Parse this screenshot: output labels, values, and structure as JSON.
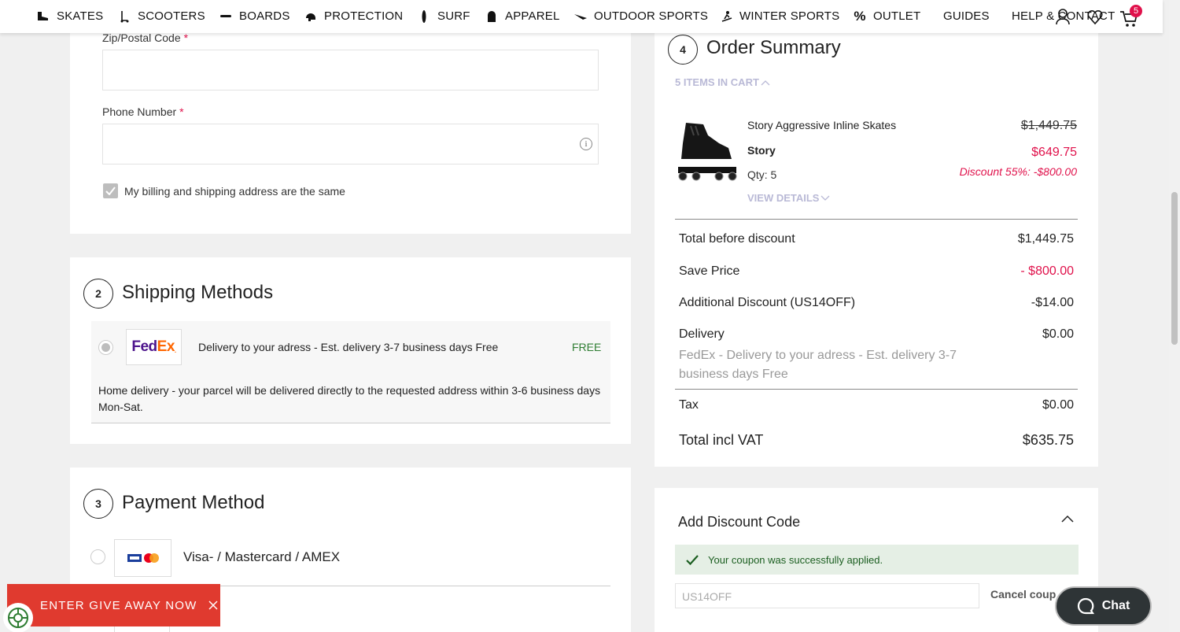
{
  "nav": {
    "items": [
      {
        "label": "SKATES",
        "icon": "skate-icon"
      },
      {
        "label": "SCOOTERS",
        "icon": "scooter-icon"
      },
      {
        "label": "BOARDS",
        "icon": "board-icon"
      },
      {
        "label": "PROTECTION",
        "icon": "helmet-icon"
      },
      {
        "label": "SURF",
        "icon": "surfboard-icon"
      },
      {
        "label": "APPAREL",
        "icon": "hoodie-icon"
      },
      {
        "label": "OUTDOOR SPORTS",
        "icon": "outdoor-icon"
      },
      {
        "label": "WINTER SPORTS",
        "icon": "skier-icon"
      },
      {
        "label": "OUTLET",
        "icon": "percent-icon"
      }
    ],
    "guides": "GUIDES",
    "help_contact": "HELP & CONTACT",
    "cart_count": "5"
  },
  "address": {
    "zip_label": "Zip/Postal Code",
    "phone_label": "Phone Number",
    "required_mark": "*",
    "zip_value": "",
    "phone_value": "",
    "billing_same_label": "My billing and shipping address are the same",
    "billing_same_checked": true
  },
  "shipping": {
    "step": "2",
    "title": "Shipping Methods",
    "carrier_logo_text_1": "Fed",
    "carrier_logo_text_2": "Ex",
    "option_label": "Delivery to your adress - Est. delivery 3-7 business days Free",
    "option_price": "FREE",
    "description": "Home delivery - your parcel will be delivered directly to the requested address within 3-6 business days Mon-Sat."
  },
  "payment": {
    "step": "3",
    "title": "Payment Method",
    "option_label": "Visa- / Mastercard / AMEX"
  },
  "order": {
    "step": "4",
    "title": "Order Summary",
    "items_in_cart": "5 ITEMS IN CART",
    "product": {
      "name": "Story Aggressive Inline Skates",
      "brand": "Story",
      "qty": "Qty: 5",
      "view_details": "VIEW DETAILS",
      "old_price": "$1,449.75",
      "price": "$649.75",
      "discount": "Discount 55%: -$800.00"
    },
    "rows": {
      "total_before_label": "Total before discount",
      "total_before_value": "$1,449.75",
      "save_label": "Save Price",
      "save_value": "- $800.00",
      "additional_label": "Additional Discount (US14OFF)",
      "additional_value": "-$14.00",
      "delivery_label": "Delivery",
      "delivery_value": "$0.00",
      "delivery_desc": "FedEx - Delivery to your adress - Est. delivery 3-7 business days Free",
      "tax_label": "Tax",
      "tax_value": "$0.00",
      "total_label": "Total incl VAT",
      "total_value": "$635.75"
    }
  },
  "discount": {
    "title": "Add Discount Code",
    "success_message": "Your coupon was successfully applied.",
    "code_value": "US14OFF",
    "cancel_label": "Cancel coup"
  },
  "promo": {
    "label": "ENTER GIVE AWAY NOW"
  },
  "chat": {
    "label": "Chat"
  },
  "colors": {
    "accent_pink": "#e0114b",
    "success_green": "#2e7d32",
    "promo_red": "#e03a2f"
  }
}
